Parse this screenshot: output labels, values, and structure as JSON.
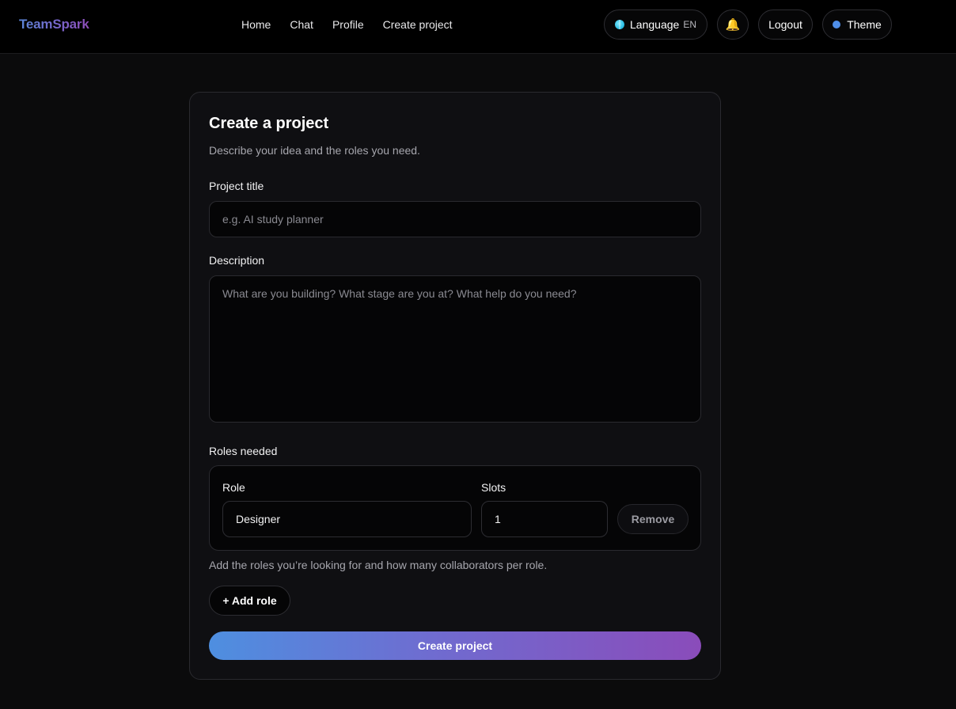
{
  "header": {
    "brand": "TeamSpark",
    "nav": [
      "Home",
      "Chat",
      "Profile",
      "Create project"
    ],
    "language_label": "Language",
    "language_code": "EN",
    "logout_label": "Logout",
    "theme_label": "Theme",
    "icons": {
      "language": "globe-icon",
      "notifications": "bell-icon",
      "theme": "theme-dot-icon"
    }
  },
  "form": {
    "title": "Create a project",
    "subtitle": "Describe your idea and the roles you need.",
    "project_title_label": "Project title",
    "project_title_placeholder": "e.g. AI study planner",
    "project_title_value": "",
    "description_label": "Description",
    "description_placeholder": "What are you building? What stage are you at? What help do you need?",
    "description_value": "",
    "roles_label": "Roles needed",
    "roles": [
      {
        "role_label": "Role",
        "role_value": "Designer",
        "slots_label": "Slots",
        "slots_value": "1",
        "remove_label": "Remove"
      }
    ],
    "roles_hint": "Add the roles you’re looking for and how many collaborators per role.",
    "add_role_label": "+ Add role",
    "submit_label": "Create project"
  },
  "colors": {
    "background": "#0b0b0c",
    "card": "#0f0f12",
    "accent_start": "#4e8fe0",
    "accent_end": "#8a4cba",
    "bell": "#f4c430",
    "theme_dot": "#4f8ee8"
  }
}
